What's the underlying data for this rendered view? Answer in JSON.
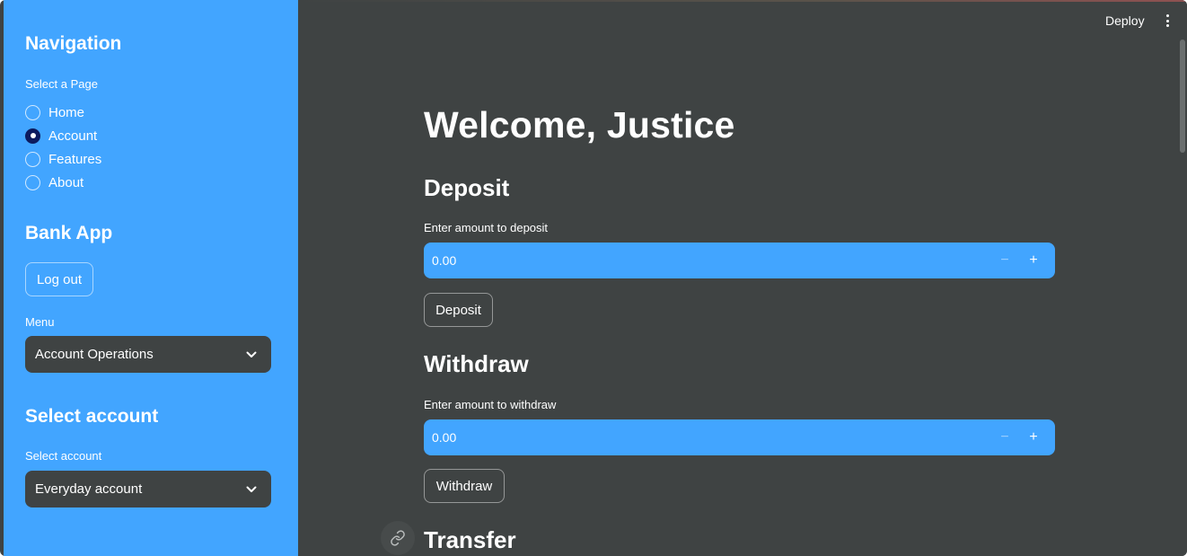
{
  "sidebar": {
    "nav_title": "Navigation",
    "page_select_label": "Select a Page",
    "pages": [
      {
        "label": "Home",
        "selected": false
      },
      {
        "label": "Account",
        "selected": true
      },
      {
        "label": "Features",
        "selected": false
      },
      {
        "label": "About",
        "selected": false
      }
    ],
    "app_title": "Bank App",
    "logout_label": "Log out",
    "menu_label": "Menu",
    "menu_value": "Account Operations",
    "account_section_title": "Select account",
    "account_select_label": "Select account",
    "account_value": "Everyday account"
  },
  "header": {
    "deploy_label": "Deploy"
  },
  "main": {
    "welcome_title": "Welcome, Justice",
    "deposit": {
      "heading": "Deposit",
      "field_label": "Enter amount to deposit",
      "value": "0.00",
      "minus": "−",
      "plus": "+",
      "button_label": "Deposit"
    },
    "withdraw": {
      "heading": "Withdraw",
      "field_label": "Enter amount to withdraw",
      "value": "0.00",
      "minus": "−",
      "plus": "+",
      "button_label": "Withdraw"
    },
    "transfer": {
      "heading": "Transfer"
    }
  },
  "colors": {
    "sidebar_bg": "#42a5ff",
    "main_bg": "#3f4343",
    "input_bg": "#42a5ff",
    "radio_selected": "#0d1b5e"
  },
  "icons": {
    "chevron": "chevron-down-icon",
    "kebab": "kebab-menu-icon",
    "link": "link-icon"
  }
}
